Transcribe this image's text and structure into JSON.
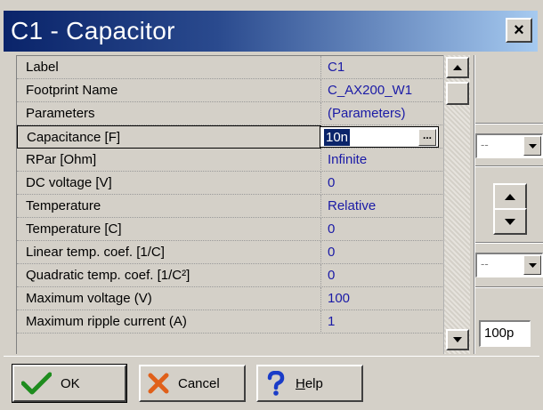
{
  "window": {
    "title": "C1 - Capacitor",
    "close_glyph": "×"
  },
  "properties": [
    {
      "label": "Label",
      "value": "C1"
    },
    {
      "label": "Footprint Name",
      "value": "C_AX200_W1"
    },
    {
      "label": "Parameters",
      "value": "(Parameters)"
    },
    {
      "label": "Capacitance  [F]",
      "value": "10n",
      "selected": true
    },
    {
      "label": "RPar        [Ohm]",
      "value": "Infinite"
    },
    {
      "label": "DC voltage  [V]",
      "value": "0"
    },
    {
      "label": "Temperature",
      "value": "Relative"
    },
    {
      "label": "Temperature [C]",
      "value": "0"
    },
    {
      "label": "Linear temp. coef. [1/C]",
      "value": "0"
    },
    {
      "label": "Quadratic temp. coef. [1/C²]",
      "value": "0"
    },
    {
      "label": "Maximum voltage (V)",
      "value": "100"
    },
    {
      "label": "Maximum ripple current (A)",
      "value": "1"
    }
  ],
  "editor": {
    "value": "10n",
    "ellipsis_label": "..."
  },
  "right_panel": {
    "unit_combo_1": "--",
    "unit_combo_2": "--",
    "preview_value": "100p"
  },
  "buttons": {
    "ok": "OK",
    "cancel": "Cancel",
    "help": "Help"
  },
  "icons": {
    "ok": "check-icon",
    "cancel": "x-icon",
    "help": "question-icon",
    "close": "close-icon",
    "scroll_up": "arrow-up-icon",
    "scroll_down": "arrow-down-icon",
    "dropdown": "chevron-down-icon"
  },
  "colors": {
    "title_bar_start": "#0a246a",
    "title_bar_end": "#a6caf0",
    "value_text": "#1a1aa6",
    "dialog_bg": "#d4d0c8",
    "ok_check": "#1e8c1e",
    "cancel_x": "#e0601a",
    "help_q": "#1a3cc8"
  }
}
